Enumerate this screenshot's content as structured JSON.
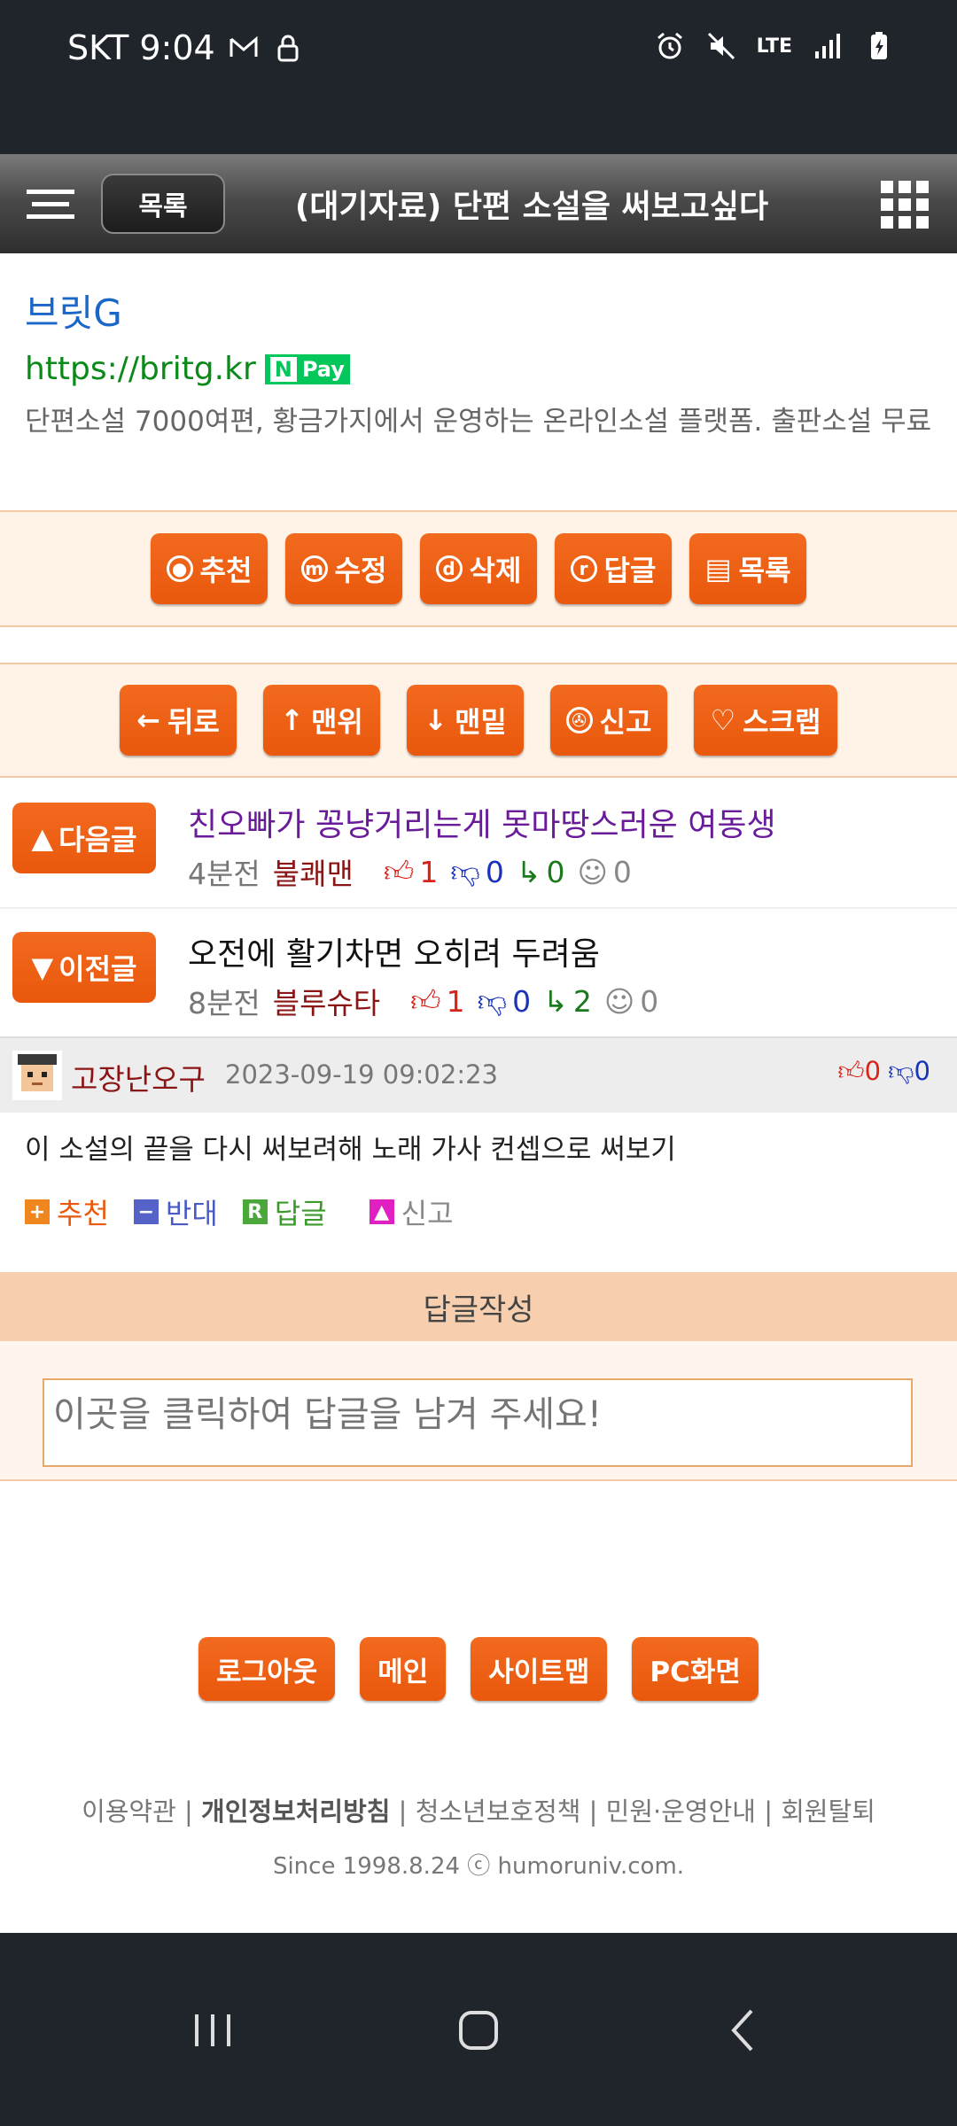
{
  "status": {
    "carrier_time": "SKT 9:04",
    "network": "LTE"
  },
  "topbar": {
    "list_label": "목록",
    "title": "(대기자료) 단편 소설을 써보고싶다"
  },
  "ad": {
    "title": "브릿G",
    "url": "https://britg.kr",
    "npay": "Pay",
    "description": "단편소설 7000여편, 황금가지에서 운영하는 온라인소설 플랫폼. 출판소설 무료"
  },
  "actions": {
    "recommend": "추천",
    "edit": "수정",
    "delete": "삭제",
    "reply": "답글",
    "list": "목록"
  },
  "nav": {
    "back": "뒤로",
    "top": "맨위",
    "bottom": "맨밑",
    "report": "신고",
    "scrap": "스크랩"
  },
  "next_post": {
    "button": "다음글",
    "title": "친오빠가 꽁냥거리는게 못마땅스러운 여동생",
    "time": "4분전",
    "author": "불쾌맨",
    "up": "1",
    "down": "0",
    "replies": "0",
    "views": "0"
  },
  "prev_post": {
    "button": "이전글",
    "title": "오전에 활기차면 오히려 두려움",
    "time": "8분전",
    "author": "블루슈타",
    "up": "1",
    "down": "0",
    "replies": "2",
    "views": "0"
  },
  "comment": {
    "user": "고장난오구",
    "date": "2023-09-19 09:02:23",
    "up": "0",
    "down": "0",
    "text": "이 소설의 끝을 다시 써보려해 노래 가사 컨셉으로 써보기",
    "recommend": "추천",
    "oppose": "반대",
    "reply": "답글",
    "report": "신고"
  },
  "reply_form": {
    "header": "답글작성",
    "placeholder": "이곳을 클릭하여 답글을 남겨 주세요!"
  },
  "footer": {
    "buttons": [
      "로그아웃",
      "메인",
      "사이트맵",
      "PC화면"
    ],
    "link_terms": "이용약관",
    "link_privacy": "개인정보처리방침",
    "link_youth": "청소년보호정책",
    "link_help": "민원·운영안내",
    "link_withdraw": "회원탈퇴",
    "since": "Since 1998.8.24 ⓒ humoruniv.com."
  },
  "colors": {
    "accent": "#e9580c",
    "status_bg": "#20252b",
    "link": "#1a66c9",
    "url": "#0b8a1a"
  }
}
